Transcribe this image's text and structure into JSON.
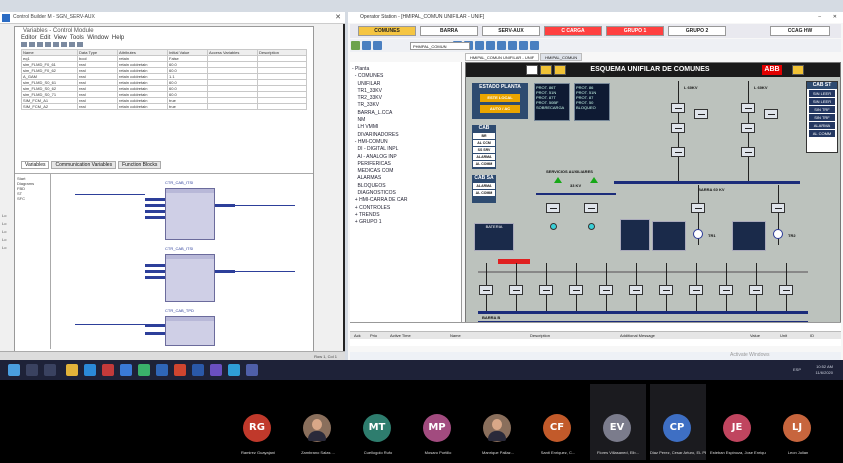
{
  "left_window": {
    "title": "Control Builder M - SGN_SERV-AUX",
    "inner_title": "Variables - Control Module",
    "menu": [
      "Editor",
      "Edit",
      "View",
      "Tools",
      "Window",
      "Help"
    ],
    "columns": [
      "Name",
      "Data Type",
      "Attributes",
      "Initial Value",
      "Access Variables",
      "Description"
    ],
    "rows": [
      [
        "eq1",
        "bool",
        "retain",
        "False"
      ],
      [
        "sim_FLMD_F0_61",
        "real",
        "retain coldretain",
        "60.0"
      ],
      [
        "sim_FLMD_F0_62",
        "real",
        "retain coldretain",
        "60.0"
      ],
      [
        "A_GAM",
        "real",
        "retain coldretain",
        "1.1"
      ],
      [
        "sim_FLMD_S0_61",
        "real",
        "retain coldretain",
        "60.0"
      ],
      [
        "sim_FLMD_S0_62",
        "real",
        "retain coldretain",
        "60.0"
      ],
      [
        "sim_FLMD_S0_71",
        "real",
        "retain coldretain",
        "60.0"
      ],
      [
        "SIM_FCM_A1",
        "real",
        "retain coldretain",
        "true"
      ],
      [
        "SIM_FCM_A2",
        "real",
        "retain coldretain",
        "true"
      ]
    ],
    "tabs": [
      "Variables",
      "Communication Variables",
      "Function Blocks"
    ],
    "left_pane": [
      "Start",
      "Diagrams",
      "FBD",
      "ST",
      "SFC"
    ],
    "fb_labels": [
      "CTR_CAB_ITSI",
      "CTR_CAB_ITSI",
      "CTR_CAB_TPD"
    ],
    "side_labels": [
      "Lo",
      "Lo",
      "Lo",
      "Lo",
      "Lo"
    ],
    "status_text": "Row 1, Col 1"
  },
  "right_window": {
    "title": "Operator Station - [HMIPAL_COMUN UNIFILAR - UNIF]",
    "nav_buttons": [
      {
        "label": "COMUNES",
        "style": "yel"
      },
      {
        "label": "BARRA",
        "style": ""
      },
      {
        "label": "SERV-AUX",
        "style": ""
      },
      {
        "label": "C CARGA",
        "style": "red"
      },
      {
        "label": "GRUPO 1",
        "style": "red"
      },
      {
        "label": "GRUPO 2",
        "style": ""
      },
      {
        "label": "CCAG HW",
        "style": ""
      }
    ],
    "address": "PHMPAL_COMUN",
    "tabs": [
      "HMIPAL_COMUN UNIFILAR - UNIF",
      "HMIPAL_COMUN"
    ],
    "tree": [
      "- Planta",
      "  - COMUNES",
      "    UNIFILAR",
      "    TR1_33KV",
      "    TR2_33KV",
      "    TR_33KV",
      "    BARRA_L.CCA",
      "    NM",
      "    LH VMMI",
      "    DIVARINADORES",
      "  - HMI-COMUN",
      "    DI - DIGITAL INPL",
      "    AI - ANALOG INP",
      "    PERIFERICAS",
      "    MEDICAS COM",
      "    ALARMAS",
      "    BLOQUEOS",
      "    DIAGNOSTICOS",
      "  + HMI-CARRA DE CAR",
      "  + CONTROLES",
      "  + TRENDS",
      "  + GRUPO 1"
    ],
    "graphic": {
      "title": "ESQUEMA UNIFILAR DE COMUNES",
      "logo": "ABB",
      "estado_planta": "ESTADO PLANTA",
      "estado_items": [
        "ESTE LOCAL",
        "AUTO / AC"
      ],
      "small_checks": [
        "PROT. 86T",
        "PROT. 51N",
        "PROT. 87T",
        "PROT. 50BF",
        "SOBRECARGA"
      ],
      "small_checks2": [
        "PROT. 86",
        "PROT. 51N",
        "PROT. 87",
        "PROT. 50",
        "BLOQUEO"
      ],
      "cab_label": "CAB",
      "cab_items": [
        "BR",
        "AL CCM",
        "SS SRV",
        "ALARMA",
        "AL COMM"
      ],
      "cab_sa_label": "CAB SA",
      "cab_sa_items": [
        "ALARMA",
        "AL COMM"
      ],
      "cab_st": {
        "title": "CAB ST",
        "items": [
          "SIN LEER",
          "SIN LEER",
          "SIN TRF",
          "SIN TRF",
          "ALARMA",
          "AL COMM"
        ]
      },
      "labels": {
        "kv_a": "L 60KV",
        "kv_b": "L 60KV",
        "kv33": "33 KV",
        "barra60": "BARRA 60 KV",
        "servicios": "SERVICIOS AUXILIARES",
        "tr1": "TR1",
        "tr2": "TR2",
        "barra_b": "BARRA B",
        "barra_a": "BARRA A"
      },
      "mini_title": "BATERIA"
    },
    "alarm_columns": [
      "Ack",
      "Prio",
      "Active Time",
      "Name",
      "Description",
      "Additional Message",
      "Value",
      "Unit",
      "ID"
    ],
    "status_left": "Ready",
    "status_right": "Activate Windows",
    "status_user": "Administrator SERVER OAFI_HMI 11/6/2020 10:52:14 AM"
  },
  "tray": {
    "time": "10:52 AM",
    "date": "11/6/2020",
    "lang": "ESP"
  },
  "participants": [
    {
      "initials": "RG",
      "name": "Ramirez Guayajani",
      "color": "#c0392b",
      "photo": false,
      "active": false
    },
    {
      "initials": "",
      "name": "Zambrano Salas ...",
      "color": "",
      "photo": true,
      "active": false
    },
    {
      "initials": "MT",
      "name": "Cuellogolo Rufo",
      "color": "#2e7d6e",
      "photo": false,
      "active": false
    },
    {
      "initials": "MP",
      "name": "Mosaro Portillo",
      "color": "#a24b7f",
      "photo": false,
      "active": false
    },
    {
      "initials": "",
      "name": "Manrique Pallaz...",
      "color": "",
      "photo": true,
      "active": false
    },
    {
      "initials": "CF",
      "name": "Santi Enriquez, C...",
      "color": "#c25a2a",
      "photo": false,
      "active": false
    },
    {
      "initials": "EV",
      "name": "Flores Villasaned, Elb...",
      "color": "#7b7c8c",
      "photo": false,
      "active": true
    },
    {
      "initials": "CP",
      "name": "Diaz Perez, Cesar Arturo, EL PERU",
      "color": "#3e6fc4",
      "photo": false,
      "active": true
    },
    {
      "initials": "JE",
      "name": "Esteban Espinoza, Jose Enrique, EL...",
      "color": "#c0455f",
      "photo": false,
      "active": false
    },
    {
      "initials": "LJ",
      "name": "Leon Julian",
      "color": "#c7653d",
      "photo": false,
      "active": false
    }
  ],
  "colors": {
    "accent_yellow": "#f5c542",
    "accent_red": "#ff4040",
    "bus_blue": "#1b2c7a",
    "abb_red": "#e10000"
  }
}
